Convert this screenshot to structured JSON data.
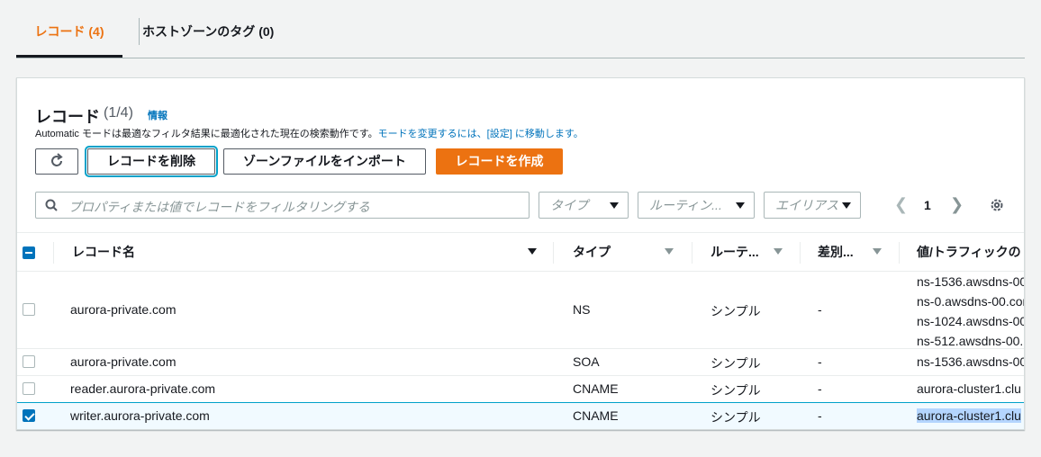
{
  "tabs": [
    {
      "label": "レコード (4)"
    },
    {
      "label": "ホストゾーンのタグ (0)"
    }
  ],
  "header": {
    "title": "レコード",
    "count": "(1/4)",
    "info_link": "情報",
    "desc_prefix": "Automatic",
    "desc_text": " モードは最適なフィルタ結果に最適化された現在の検索動作です。",
    "desc_link": "モードを変更するには、[設定] に移動します。"
  },
  "buttons": {
    "delete": "レコードを削除",
    "import": "ゾーンファイルをインポート",
    "create": "レコードを作成"
  },
  "filters": {
    "search_placeholder": "プロパティまたは値でレコードをフィルタリングする",
    "type": "タイプ",
    "routing": "ルーティン...",
    "alias": "エイリアス"
  },
  "pager": {
    "page": "1"
  },
  "columns": {
    "name": "レコード名",
    "type": "タイプ",
    "routing": "ルーテ...",
    "diff": "差別...",
    "value": "値/トラフィックの"
  },
  "rows": [
    {
      "name": "aurora-private.com",
      "type": "NS",
      "routing": "シンプル",
      "diff": "-",
      "values": [
        "ns-1536.awsdns-00",
        "ns-0.awsdns-00.com",
        "ns-1024.awsdns-00",
        "ns-512.awsdns-00."
      ],
      "checked": false
    },
    {
      "name": "aurora-private.com",
      "type": "SOA",
      "routing": "シンプル",
      "diff": "-",
      "values": [
        "ns-1536.awsdns-00"
      ],
      "checked": false
    },
    {
      "name": "reader.aurora-private.com",
      "type": "CNAME",
      "routing": "シンプル",
      "diff": "-",
      "values": [
        "aurora-cluster1.clu"
      ],
      "checked": false
    },
    {
      "name": "writer.aurora-private.com",
      "type": "CNAME",
      "routing": "シンプル",
      "diff": "-",
      "values": [
        "aurora-cluster1.clu"
      ],
      "checked": true
    }
  ],
  "colors": {
    "accent": "#ec7211",
    "link": "#0073bb",
    "selected_border": "#00a1c9"
  }
}
